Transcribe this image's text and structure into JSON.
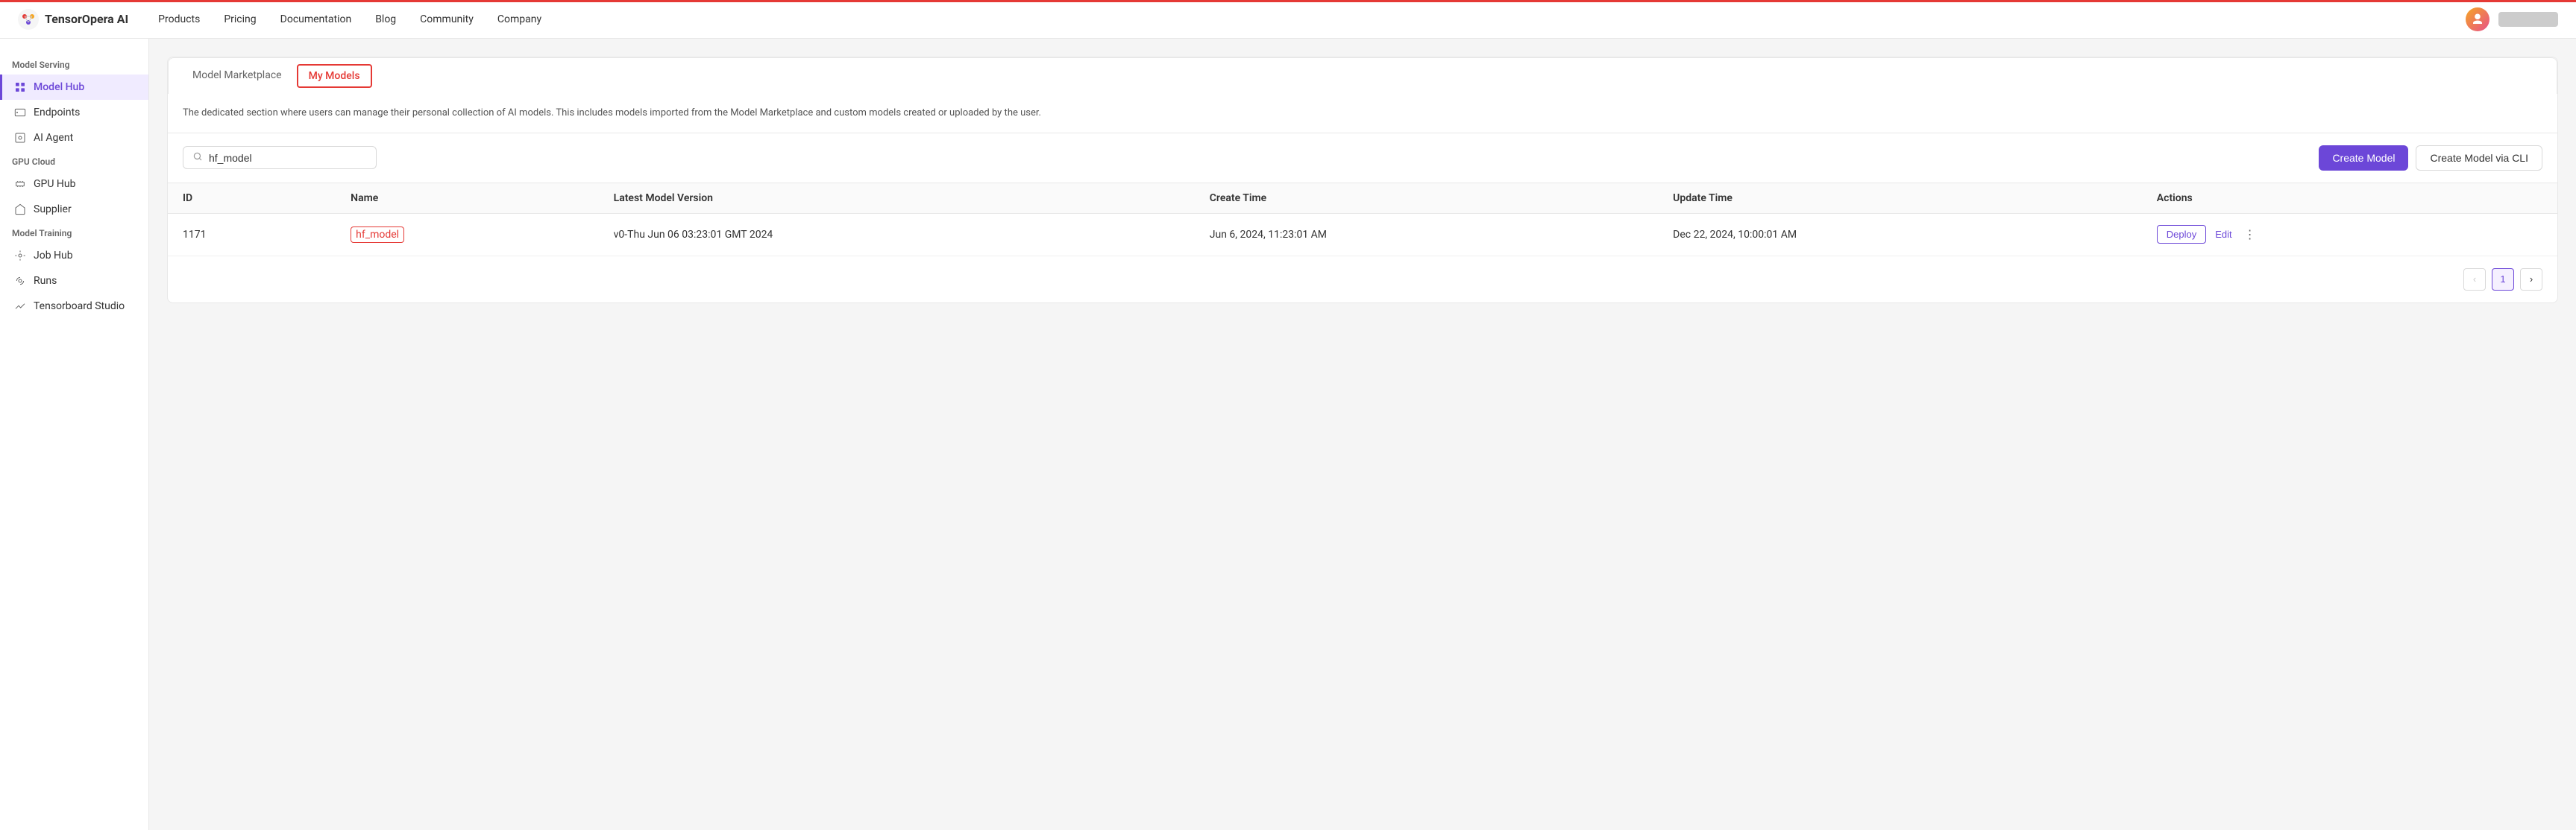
{
  "topAccent": true,
  "navbar": {
    "logo_text": "TensorOpera AI",
    "nav_items": [
      "Products",
      "Pricing",
      "Documentation",
      "Blog",
      "Community",
      "Company"
    ]
  },
  "sidebar": {
    "sections": [
      {
        "label": "Model Serving",
        "items": [
          {
            "id": "model-hub",
            "label": "Model Hub",
            "active": true,
            "icon": "cube"
          },
          {
            "id": "endpoints",
            "label": "Endpoints",
            "active": false,
            "icon": "server"
          },
          {
            "id": "ai-agent",
            "label": "AI Agent",
            "active": false,
            "icon": "monitor"
          }
        ]
      },
      {
        "label": "GPU Cloud",
        "items": [
          {
            "id": "gpu-hub",
            "label": "GPU Hub",
            "active": false,
            "icon": "chip"
          },
          {
            "id": "supplier",
            "label": "Supplier",
            "active": false,
            "icon": "shop"
          }
        ]
      },
      {
        "label": "Model Training",
        "items": [
          {
            "id": "job-hub",
            "label": "Job Hub",
            "active": false,
            "icon": "jobs"
          },
          {
            "id": "runs",
            "label": "Runs",
            "active": false,
            "icon": "runs"
          },
          {
            "id": "tensorboard-studio",
            "label": "Tensorboard Studio",
            "active": false,
            "icon": "chart"
          }
        ]
      }
    ]
  },
  "tabs": [
    {
      "id": "model-marketplace",
      "label": "Model Marketplace",
      "active": false
    },
    {
      "id": "my-models",
      "label": "My Models",
      "active": true
    }
  ],
  "description": "The dedicated section where users can manage their personal collection of AI models. This includes models imported from the Model Marketplace and custom models created or uploaded by the user.",
  "toolbar": {
    "search_placeholder": "hf_model",
    "search_value": "hf_model",
    "btn_create_model": "Create Model",
    "btn_create_model_cli": "Create Model via CLI"
  },
  "table": {
    "columns": [
      "ID",
      "Name",
      "Latest Model Version",
      "Create Time",
      "Update Time",
      "Actions"
    ],
    "rows": [
      {
        "id": "1171",
        "name": "hf_model",
        "latest_version": "v0-Thu Jun 06 03:23:01 GMT 2024",
        "create_time": "Jun 6, 2024, 11:23:01 AM",
        "update_time": "Dec 22, 2024, 10:00:01 AM",
        "actions": {
          "deploy": "Deploy",
          "edit": "Edit"
        }
      }
    ]
  },
  "pagination": {
    "prev_label": "‹",
    "next_label": "›",
    "current_page": "1"
  }
}
